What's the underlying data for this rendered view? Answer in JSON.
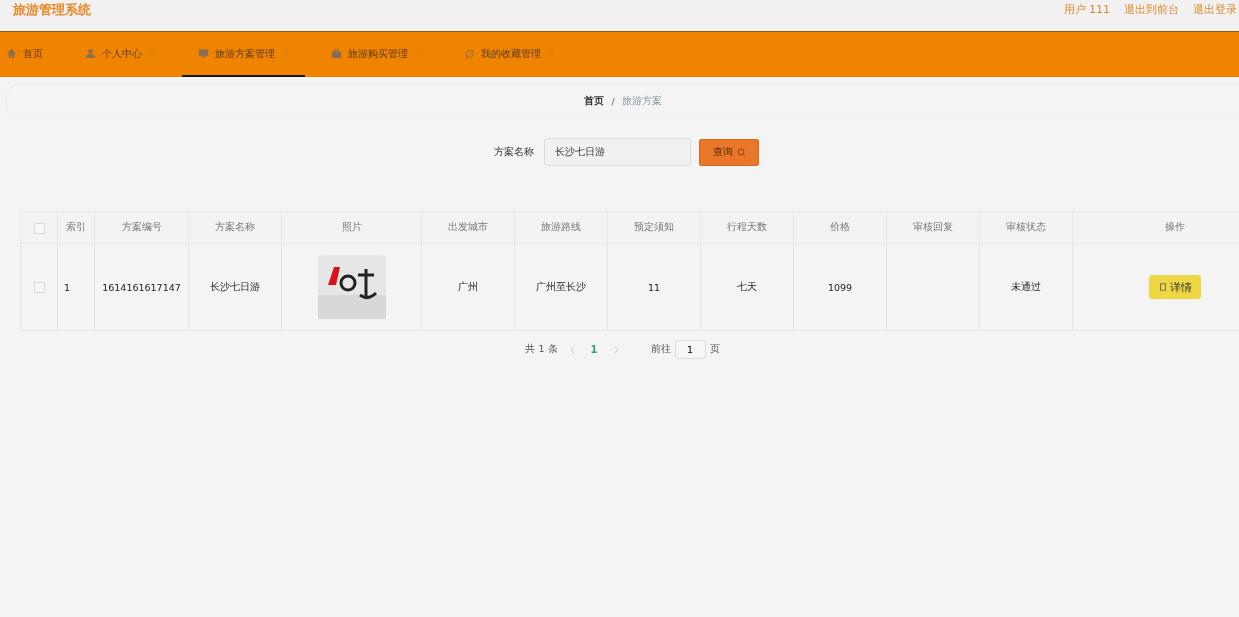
{
  "header": {
    "title": "旅游管理系统",
    "links": [
      "用户 111",
      "退出到前台",
      "退出登录"
    ]
  },
  "nav": [
    {
      "label": "首页",
      "kind": "link",
      "selected": false
    },
    {
      "label": "个人中心",
      "kind": "submenu",
      "selected": false
    },
    {
      "label": "旅游方案管理",
      "kind": "submenu",
      "selected": true
    },
    {
      "label": "旅游购买管理",
      "kind": "submenu",
      "selected": false
    },
    {
      "label": "我的收藏管理",
      "kind": "submenu",
      "selected": false
    }
  ],
  "breadcrumb": [
    "首页",
    "/",
    "旅游方案"
  ],
  "search": {
    "label": "方案名称",
    "value": "长沙七日游",
    "button": "查询"
  },
  "table": {
    "select_all": false,
    "columns": [
      "索引",
      "方案编号",
      "方案名称",
      "照片",
      "出发城市",
      "旅游路线",
      "预定须知",
      "行程天数",
      "价格",
      "审核回复",
      "审核状态",
      "操作"
    ],
    "rows": [
      {
        "checked": false,
        "cells": [
          "1",
          "1614161617147",
          "长沙七日游",
          {
            "kind": "picture"
          },
          "广州",
          "广州至长沙",
          "11",
          "七天",
          "1099",
          "",
          "未通过"
        ],
        "action": "详情"
      }
    ]
  },
  "pagination": {
    "total": "共 1 条",
    "pages": [
      {
        "label": "1",
        "selected": true
      }
    ],
    "goto_label": "前往",
    "goto_value": "1",
    "goto_suffix": "页"
  }
}
